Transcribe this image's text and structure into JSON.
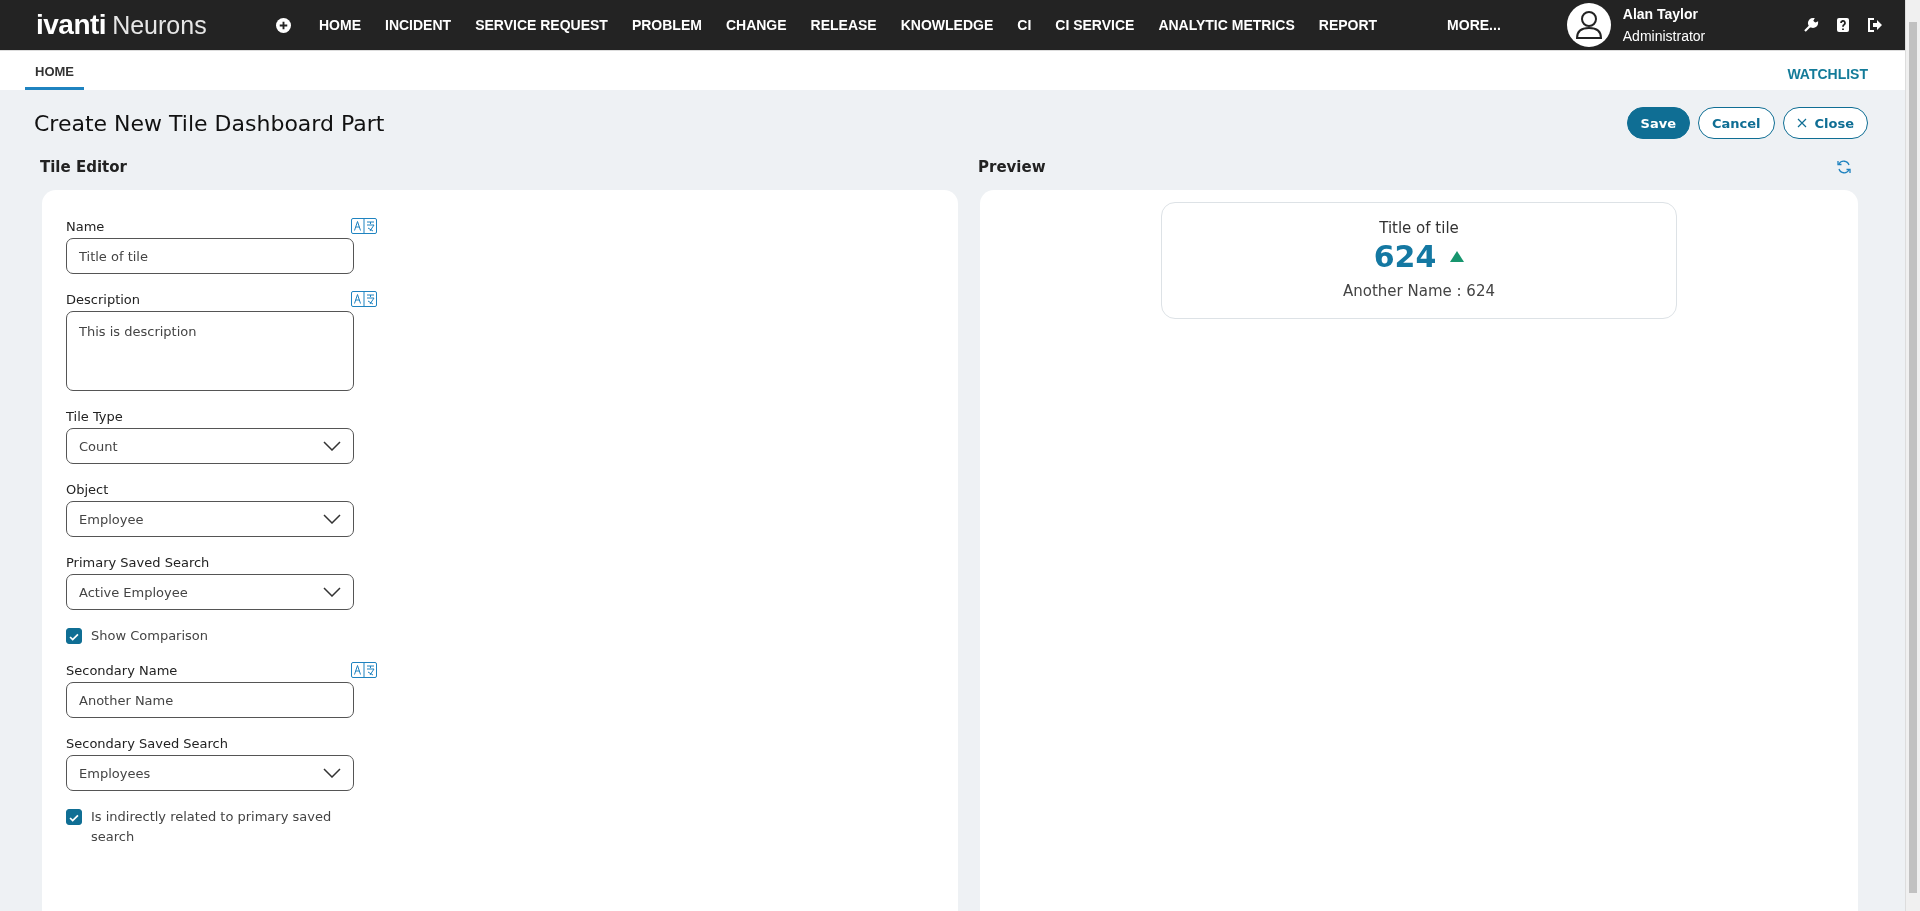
{
  "header": {
    "logo": {
      "brand": "ivanti",
      "product": "Neurons"
    },
    "nav": [
      {
        "label": "HOME"
      },
      {
        "label": "INCIDENT"
      },
      {
        "label": "SERVICE REQUEST"
      },
      {
        "label": "PROBLEM"
      },
      {
        "label": "CHANGE"
      },
      {
        "label": "RELEASE"
      },
      {
        "label": "KNOWLEDGE"
      },
      {
        "label": "CI"
      },
      {
        "label": "CI SERVICE"
      },
      {
        "label": "ANALYTIC METRICS"
      },
      {
        "label": "REPORT"
      }
    ],
    "more": "MORE...",
    "user": {
      "name": "Alan Taylor",
      "role": "Administrator"
    }
  },
  "tabs": [
    {
      "label": "HOME",
      "selected": true
    }
  ],
  "watchlist": "WATCHLIST",
  "page_title": "Create New Tile Dashboard Part",
  "buttons": [
    {
      "label": "Save",
      "kind": "primary"
    },
    {
      "label": "Cancel",
      "kind": "outline"
    },
    {
      "label": "Close",
      "kind": "close"
    }
  ],
  "editor": {
    "title": "Tile Editor",
    "fields": [
      {
        "kind": "text",
        "label": "Name",
        "translatable": true,
        "value": "Title of tile"
      },
      {
        "kind": "textarea",
        "label": "Description",
        "translatable": true,
        "value": "This is description"
      },
      {
        "kind": "select",
        "label": "Tile Type",
        "translatable": false,
        "value": "Count"
      },
      {
        "kind": "select",
        "label": "Object",
        "translatable": false,
        "value": "Employee"
      },
      {
        "kind": "select",
        "label": "Primary Saved Search",
        "translatable": false,
        "value": "Active Employee"
      },
      {
        "kind": "checkbox",
        "label": "Show Comparison",
        "checked": true
      },
      {
        "kind": "text",
        "label": "Secondary Name",
        "translatable": true,
        "value": "Another Name"
      },
      {
        "kind": "select",
        "label": "Secondary Saved Search",
        "translatable": false,
        "value": "Employees"
      },
      {
        "kind": "checkbox",
        "label": "Is indirectly related to primary saved search",
        "checked": true
      }
    ]
  },
  "preview": {
    "title": "Preview",
    "tile": {
      "title": "Title of tile",
      "value": "624",
      "rising": true,
      "secondary": "Another Name : 624"
    }
  }
}
